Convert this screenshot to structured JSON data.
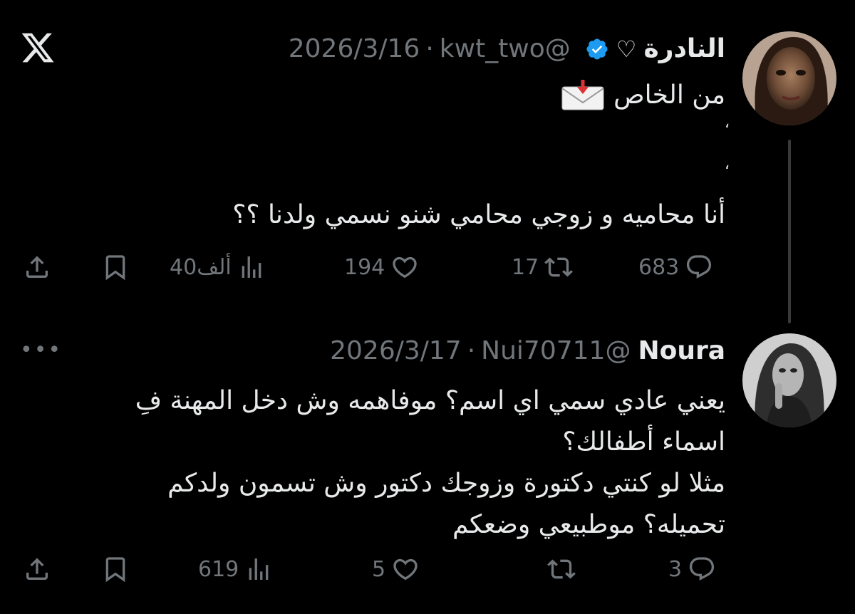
{
  "tweet1": {
    "name": "النادرة",
    "name_suffix": "♡",
    "handle": "@kwt_two",
    "separator": "·",
    "date": "2026/3/16",
    "lines": [
      "من الخاص",
      "،",
      "،",
      "أنا محاميه و زوجي محامي شنو نسمي ولدنا ؟؟"
    ],
    "stats": {
      "views": "40ألف",
      "likes": "194",
      "retweets": "17",
      "replies": "683"
    }
  },
  "tweet2": {
    "name": "Noura",
    "handle": "@Nui70711",
    "separator": "·",
    "date": "2026/3/17",
    "more": "•••",
    "lines": [
      "يعني عادي سمي اي اسم؟ موفاهمه وش دخل المهنة فِ",
      "اسماء أطفالك؟",
      "مثلا لو كنتي دكتورة وزوجك دكتور وش تسمون ولدكم",
      "تحميله؟ موطبيعي وضعكم"
    ],
    "stats": {
      "views": "619",
      "likes": "5",
      "retweets": "",
      "replies": "3"
    }
  },
  "colors": {
    "background": "#000000",
    "text": "#e7e9ea",
    "muted": "#71767b",
    "verified": "#1d9bf0"
  },
  "icons": [
    "x-logo-icon",
    "verified-icon",
    "envelope-icon",
    "share-icon",
    "bookmark-icon",
    "views-icon",
    "like-icon",
    "retweet-icon",
    "reply-icon",
    "more-icon"
  ]
}
